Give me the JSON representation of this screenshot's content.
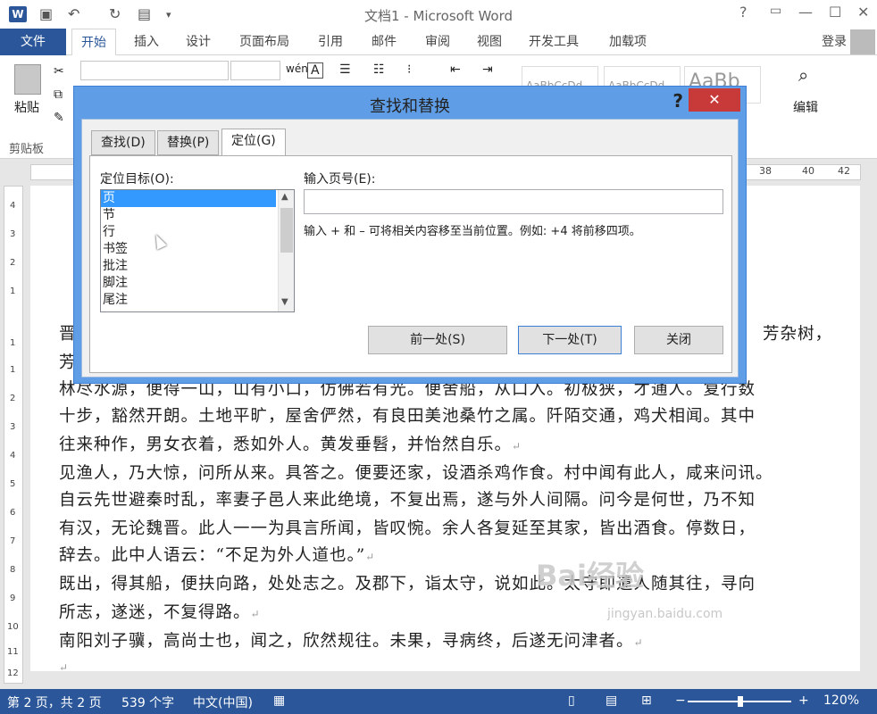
{
  "window": {
    "title": "文档1 - Microsoft Word",
    "help": "?",
    "minimize": "—",
    "restore": "☐",
    "close": "✕"
  },
  "ribbon": {
    "file_tab": "文件",
    "tabs": [
      "开始",
      "插入",
      "设计",
      "页面布局",
      "引用",
      "邮件",
      "审阅",
      "视图",
      "开发工具",
      "加载项"
    ],
    "login": "登录",
    "paste": "粘贴",
    "clipboard": "剪贴板",
    "styles": [
      "AaBbCcDd",
      "AaBbCcDd",
      "AaBb"
    ],
    "edit": "编辑"
  },
  "ruler": {
    "numbers": [
      "38",
      "40",
      "42"
    ],
    "vertical": [
      "4",
      "3",
      "2",
      "1",
      "1",
      "1",
      "2",
      "3",
      "4",
      "5",
      "6",
      "7",
      "8",
      "9",
      "10",
      "11",
      "12"
    ]
  },
  "document": {
    "lines": [
      "晋",
      "芳",
      "林尽水源，便得一山，山有小口，仿佛若有光。便舍船，从口入。初极狭，才通人。复行数",
      "十步，豁然开朗。土地平旷，屋舍俨然，有良田美池桑竹之属。阡陌交通，鸡犬相闻。其中",
      "往来种作，男女衣着，悉如外人。黄发垂髫，并怡然自乐。",
      "见渔人，乃大惊，问所从来。具答之。便要还家，设酒杀鸡作食。村中闻有此人，咸来问讯。",
      "自云先世避秦时乱，率妻子邑人来此绝境，不复出焉，遂与外人间隔。问今是何世，乃不知",
      "有汉，无论魏晋。此人一一为具言所闻，皆叹惋。余人各复延至其家，皆出酒食。停数日，",
      "辞去。此中人语云：“不足为外人道也。”",
      "既出，得其船，便扶向路，处处志之。及郡下，诣太守，说如此。太守即遣人随其往，寻向",
      "所志，遂迷，不复得路。",
      "南阳刘子骥，高尚士也，闻之，欣然规往。未果，寻病终，后遂无问津者。"
    ],
    "right_fragment": "芳杂树，",
    "para_mark": "↵"
  },
  "dialog": {
    "title": "查找和替换",
    "help": "?",
    "close": "✕",
    "tabs": [
      "查找(D)",
      "替换(P)",
      "定位(G)"
    ],
    "goto_target_label": "定位目标(O):",
    "goto_targets": [
      "页",
      "节",
      "行",
      "书签",
      "批注",
      "脚注",
      "尾注"
    ],
    "page_number_label": "输入页号(E):",
    "page_number_value": "",
    "hint": "输入 + 和 – 可将相关内容移至当前位置。例如: +4 将前移四项。",
    "prev_button": "前一处(S)",
    "next_button": "下一处(T)",
    "close_button": "关闭"
  },
  "status": {
    "page": "第 2 页，共 2 页",
    "words": "539 个字",
    "language": "中文(中国)",
    "zoom": "120%",
    "minus": "−",
    "plus": "+"
  },
  "watermark": {
    "text": "Bai经验",
    "url": "jingyan.baidu.com"
  }
}
